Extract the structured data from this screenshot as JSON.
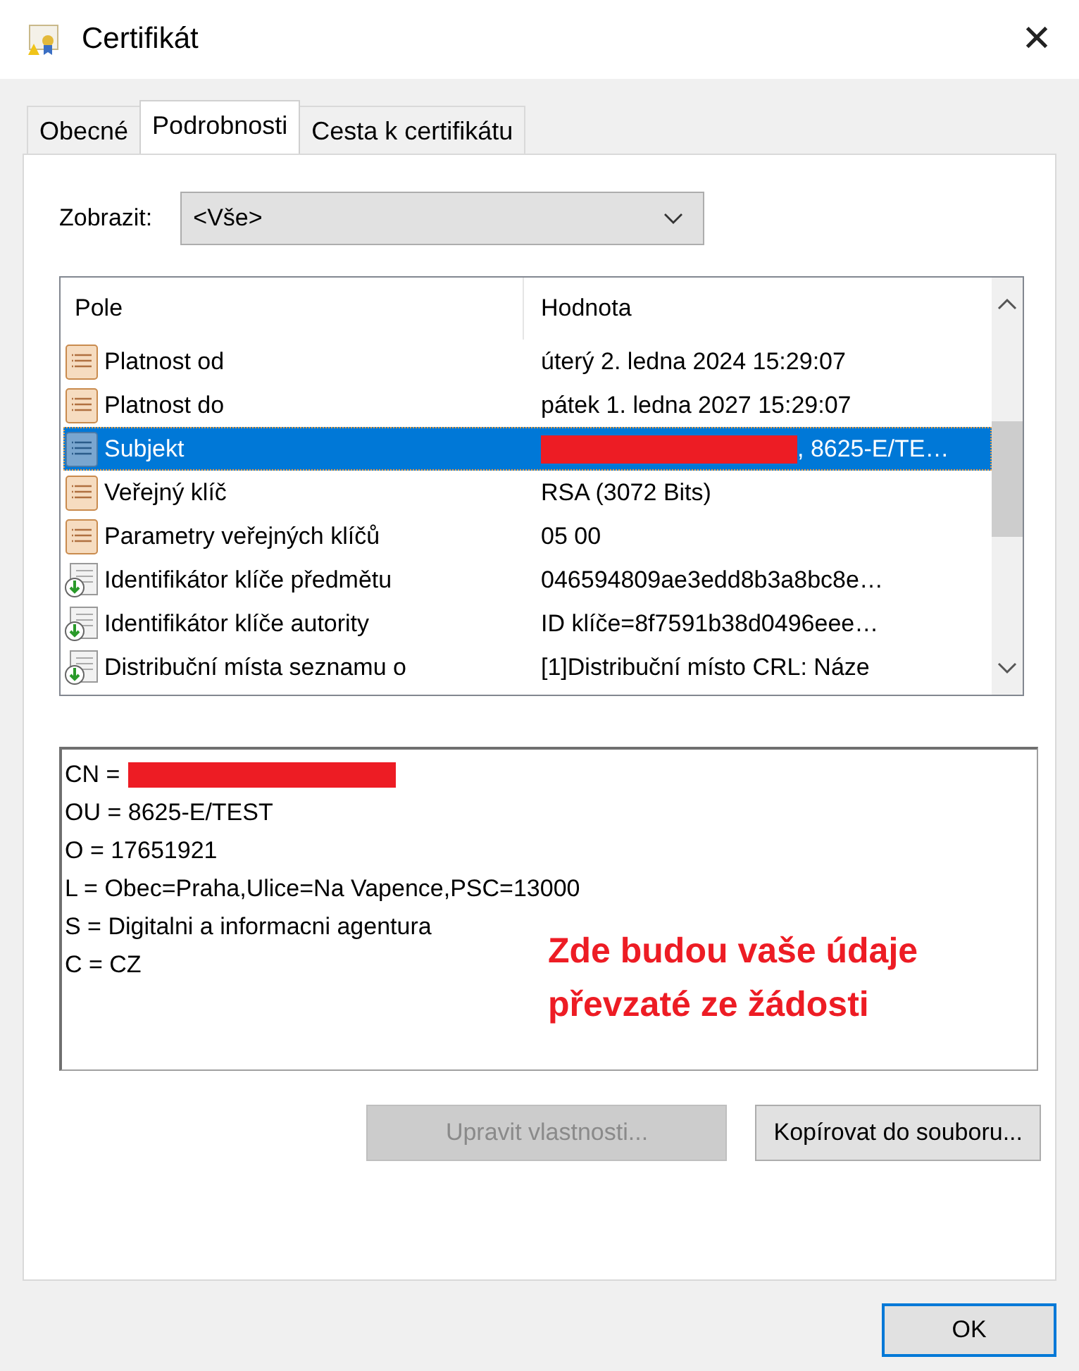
{
  "window": {
    "title": "Certifikát",
    "close": "✕"
  },
  "tabs": [
    {
      "label": "Obecné",
      "selected": false
    },
    {
      "label": "Podrobnosti",
      "selected": true
    },
    {
      "label": "Cesta k certifikátu",
      "selected": false
    }
  ],
  "show": {
    "label": "Zobrazit:",
    "value": "<Vše>"
  },
  "table": {
    "columns": [
      "Pole",
      "Hodnota"
    ],
    "rows": [
      {
        "kind": "field",
        "field": "Platnost od",
        "value": "úterý 2. ledna 2024 15:29:07",
        "selected": false,
        "redacted": false
      },
      {
        "kind": "field",
        "field": "Platnost do",
        "value": "pátek 1. ledna 2027 15:29:07",
        "selected": false,
        "redacted": false
      },
      {
        "kind": "field",
        "field": "Subjekt",
        "value": ", 8625-E/TE…",
        "selected": true,
        "redacted": true
      },
      {
        "kind": "field",
        "field": "Veřejný klíč",
        "value": "RSA (3072 Bits)",
        "selected": false,
        "redacted": false
      },
      {
        "kind": "field",
        "field": "Parametry veřejných klíčů",
        "value": "05 00",
        "selected": false,
        "redacted": false
      },
      {
        "kind": "extension",
        "field": "Identifikátor klíče předmětu",
        "value": "046594809ae3edd8b3a8bc8e…",
        "selected": false,
        "redacted": false
      },
      {
        "kind": "extension",
        "field": "Identifikátor klíče autority",
        "value": "ID klíče=8f7591b38d0496eee…",
        "selected": false,
        "redacted": false
      },
      {
        "kind": "extension",
        "field": "Distribuční místa seznamu o",
        "value": "[1]Distribuční místo CRL: Náze",
        "selected": false,
        "redacted": false
      }
    ]
  },
  "details": [
    {
      "text": "CN =",
      "redacted": true
    },
    {
      "text": "OU = 8625-E/TEST",
      "redacted": false
    },
    {
      "text": "O = 17651921",
      "redacted": false
    },
    {
      "text": "L = Obec=Praha,Ulice=Na Vapence,PSC=13000",
      "redacted": false
    },
    {
      "text": "S = Digitalni a informacni agentura",
      "redacted": false
    },
    {
      "text": "C = CZ",
      "redacted": false
    }
  ],
  "note": "Zde budou vaše údaje převzaté ze žádosti",
  "buttons": [
    {
      "label": "Upravit vlastnosti...",
      "disabled": true
    },
    {
      "label": "Kopírovat do souboru...",
      "disabled": false
    }
  ],
  "ok": "OK"
}
